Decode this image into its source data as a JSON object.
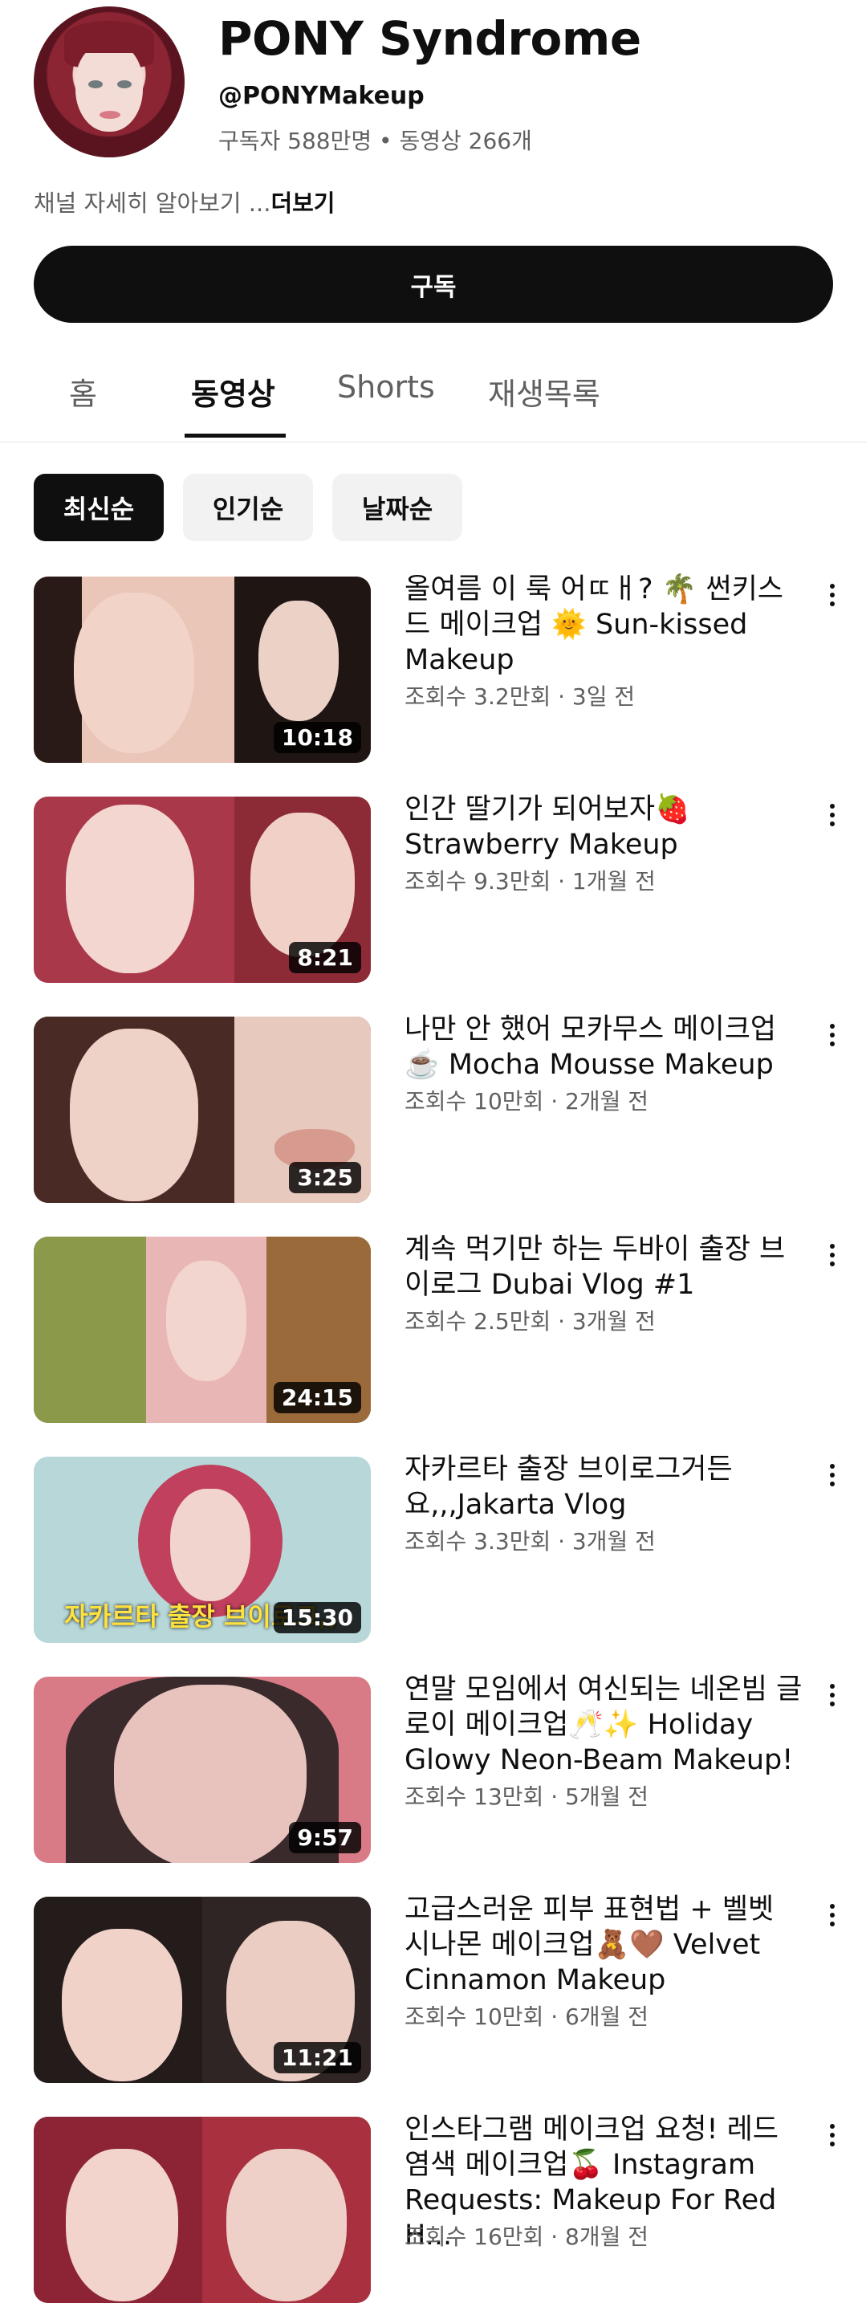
{
  "channel": {
    "name": "PONY Syndrome",
    "handle": "@PONYMakeup",
    "stats": "구독자 588만명 • 동영상 266개",
    "about_prefix": "채널 자세히 알아보기 ...",
    "about_more": "더보기",
    "subscribe_label": "구독"
  },
  "tabs": [
    {
      "label": "홈",
      "active": false
    },
    {
      "label": "동영상",
      "active": true
    },
    {
      "label": "Shorts",
      "active": false
    },
    {
      "label": "재생목록",
      "active": false
    }
  ],
  "chips": [
    {
      "label": "최신순",
      "active": true
    },
    {
      "label": "인기순",
      "active": false
    },
    {
      "label": "날짜순",
      "active": false
    }
  ],
  "videos": [
    {
      "title": "올여름 이 룩 어ㄸㅐ? 🌴 썬키스드 메이크업 🌞 Sun-kissed Makeup",
      "meta": "조회수 3.2만회 · 3일 전",
      "duration": "10:18"
    },
    {
      "title": "인간 딸기가 되어보자🍓 Strawberry Makeup",
      "meta": "조회수 9.3만회 · 1개월 전",
      "duration": "8:21"
    },
    {
      "title": "나만 안 했어 모카무스 메이크업 ☕️ Mocha Mousse Makeup",
      "meta": "조회수 10만회 · 2개월 전",
      "duration": "3:25"
    },
    {
      "title": "계속 먹기만 하는 두바이 출장 브이로그 Dubai Vlog #1",
      "meta": "조회수 2.5만회 · 3개월 전",
      "duration": "24:15"
    },
    {
      "title": "자카르타 출장 브이로그거든요,,,Jakarta Vlog",
      "meta": "조회수 3.3만회 · 3개월 전",
      "duration": "15:30",
      "overlay": "자카르타 출장 브이로그,,"
    },
    {
      "title": "연말 모임에서 여신되는 네온빔 글로이 메이크업🥂✨ Holiday Glowy Neon-Beam Makeup!",
      "meta": "조회수 13만회 · 5개월 전",
      "duration": "9:57"
    },
    {
      "title": "고급스러운 피부 표현법 + 벨벳 시나몬 메이크업🧸🤎 Velvet Cinnamon Makeup",
      "meta": "조회수 10만회 · 6개월 전",
      "duration": "11:21"
    },
    {
      "title": "인스타그램 메이크업 요청! 레드 염색 메이크업🍒 Instagram Requests: Makeup For Red H...",
      "meta": "조회수 16만회 · 8개월 전",
      "duration": ""
    }
  ]
}
